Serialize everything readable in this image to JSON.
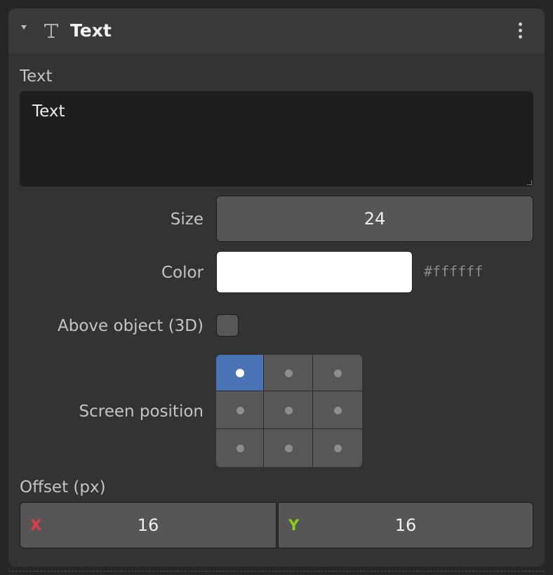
{
  "header": {
    "title": "Text",
    "icon": "text-type-icon",
    "menu_icon": "kebab-menu-icon"
  },
  "text_section": {
    "label": "Text",
    "value": "Text"
  },
  "size": {
    "label": "Size",
    "value": "24"
  },
  "color": {
    "label": "Color",
    "value": "#ffffff",
    "hex_text": "#ffffff"
  },
  "above_object": {
    "label": "Above object (3D)",
    "checked": false
  },
  "screen_position": {
    "label": "Screen position",
    "selected_index": 0,
    "cells": 9,
    "selected_color": "#4a73b5"
  },
  "offset": {
    "label": "Offset (px)",
    "x": {
      "axis": "X",
      "value": "16",
      "color": "#e23a4c"
    },
    "y": {
      "axis": "Y",
      "value": "16",
      "color": "#8bcc1a"
    }
  }
}
